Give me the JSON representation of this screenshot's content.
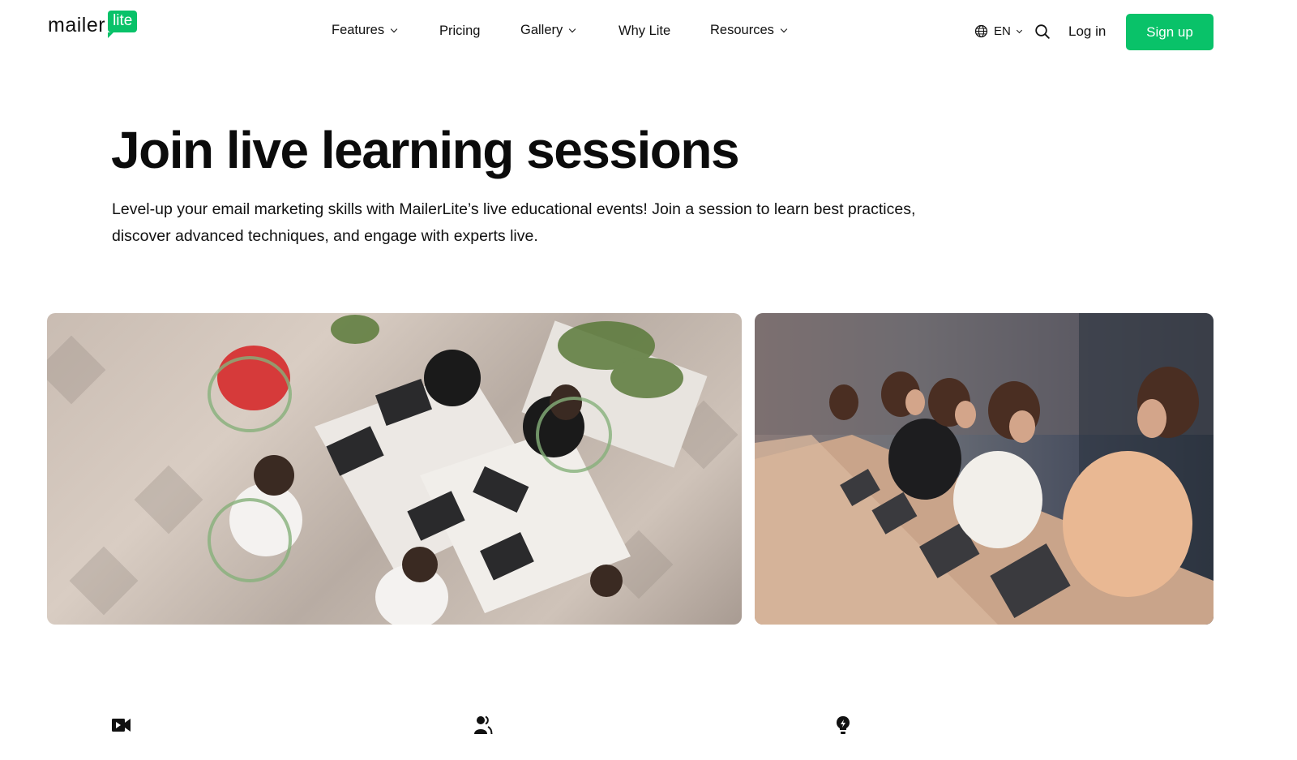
{
  "header": {
    "logo": {
      "word": "mailer",
      "badge": "lite",
      "badge_color": "#09c269"
    },
    "nav": [
      {
        "label": "Features",
        "has_dropdown": true
      },
      {
        "label": "Pricing",
        "has_dropdown": false
      },
      {
        "label": "Gallery",
        "has_dropdown": true
      },
      {
        "label": "Why Lite",
        "has_dropdown": false
      },
      {
        "label": "Resources",
        "has_dropdown": true
      }
    ],
    "language": {
      "icon": "globe-icon",
      "label": "EN"
    },
    "search": {
      "icon": "search-icon"
    },
    "login_label": "Log in",
    "signup_label": "Sign up",
    "accent_color": "#09c269"
  },
  "hero": {
    "title": "Join live learning sessions",
    "subtitle": "Level-up your email marketing skills with MailerLite’s live educational events! Join a session to learn best practices, discover advanced techniques, and engage with experts live."
  },
  "photos": [
    {
      "alt": "Overhead view of people working on laptops around white tables"
    },
    {
      "alt": "Row of people seated at a long desk working on laptops"
    }
  ],
  "features": [
    {
      "icon": "video-camera-icon"
    },
    {
      "icon": "user-group-icon"
    },
    {
      "icon": "lightbulb-icon"
    }
  ]
}
